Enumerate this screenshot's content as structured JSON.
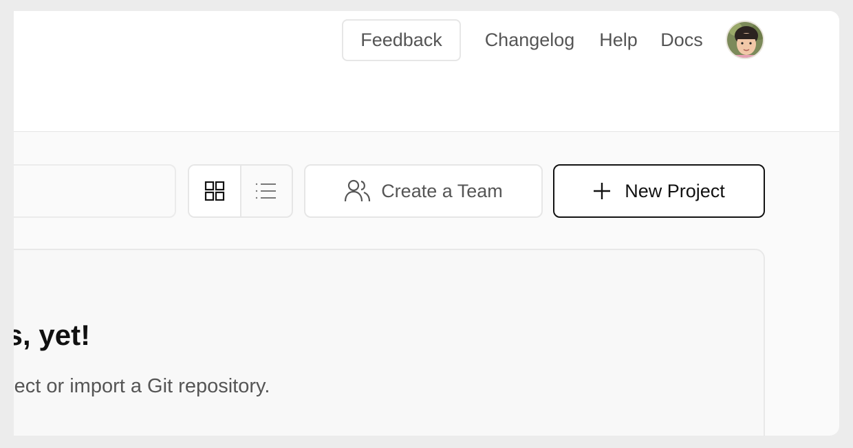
{
  "header": {
    "feedback_label": "Feedback",
    "nav": [
      {
        "label": "Changelog"
      },
      {
        "label": "Help"
      },
      {
        "label": "Docs"
      }
    ]
  },
  "toolbar": {
    "view_modes": [
      "grid",
      "list"
    ],
    "active_view": "grid",
    "create_team_label": "Create a Team",
    "new_project_label": "New Project"
  },
  "empty_state": {
    "title": "No projects, yet!",
    "subtitle": "Create a project or import a Git repository."
  },
  "colors": {
    "background": "#fafafa",
    "header_background": "#ffffff",
    "text_primary": "#111111",
    "text_secondary": "#555555",
    "border": "#e6e6e6"
  }
}
